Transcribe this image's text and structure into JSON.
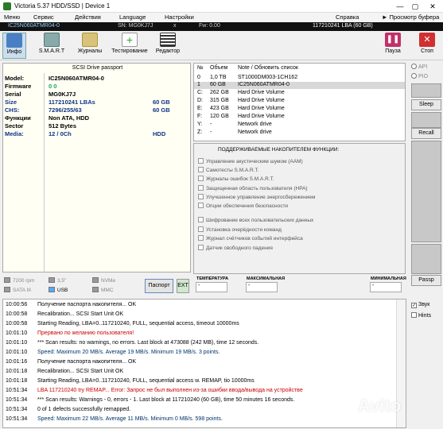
{
  "window": {
    "title": "Victoria 5.37 HDD/SSD | Device 1",
    "controls": [
      "—",
      "▢",
      "✕"
    ]
  },
  "menu": {
    "items": [
      "Меню",
      "Сервис",
      "Действия",
      "Language",
      "Настройки"
    ],
    "right": [
      "Справка",
      "► Просмотр буфера"
    ]
  },
  "status": {
    "model": "IC25N060ATMR04-0",
    "sn": "SN: MG0KJ7J",
    "x": "x",
    "fw": "Fw: 0.00",
    "lba": "117210241 LBA (60 GB)"
  },
  "toolbar": {
    "items": [
      "Инфо",
      "S.M.A.R.T",
      "Журналы",
      "Тестирование",
      "Редактор"
    ],
    "pause": "Пауза",
    "stop": "Стоп"
  },
  "passport": {
    "header": "SCSI  Drive passport",
    "rows": [
      {
        "k": "Model:",
        "v": "IC25N060ATMR04-0",
        "e": ""
      },
      {
        "k": "Firmware",
        "v": "0 0",
        "e": ""
      },
      {
        "k": "Serial",
        "v": "MG0KJ7J",
        "e": ""
      },
      {
        "k": "Size",
        "v": "117210241 LBAs",
        "e": "60 GB"
      },
      {
        "k": "CHS:",
        "v": "7296/255/63",
        "e": "60 GB"
      },
      {
        "k": "Функции",
        "v": "Non ATA, HDD",
        "e": ""
      },
      {
        "k": "Sector",
        "v": "512 Bytes",
        "e": ""
      },
      {
        "k": "Media:",
        "v": "12 / 0Ch",
        "e": "HDD"
      }
    ]
  },
  "drives": {
    "headers": [
      "№",
      "Объем",
      "Note / Обновить список"
    ],
    "rows": [
      {
        "n": "0",
        "size": "1,0 TB",
        "note": "ST1000DM003-1CH162"
      },
      {
        "n": "1",
        "size": "60 GB",
        "note": "IC25N060ATMR04-0"
      },
      {
        "n": "C:",
        "size": "262 GB",
        "note": "Hard Drive Volume"
      },
      {
        "n": "D:",
        "size": "315 GB",
        "note": "Hard Drive Volume"
      },
      {
        "n": "E:",
        "size": "423 GB",
        "note": "Hard Drive Volume"
      },
      {
        "n": "F:",
        "size": "120 GB",
        "note": "Hard Drive Volume"
      },
      {
        "n": "Y:",
        "size": "-",
        "note": "Network drive"
      },
      {
        "n": "Z:",
        "size": "-",
        "note": "Network drive"
      }
    ]
  },
  "functions": {
    "header": "ПОДДЕРЖИВАЕМЫЕ НАКОПИТЕЛЕМ ФУНКЦИИ:",
    "items": [
      "Управление акустическим шумом (AAM)",
      "Самотесты S.M.A.R.T.",
      "Журналы ошибок S.M.A.R.T.",
      "Защищенная область пользователя (HPA)",
      "Улучшенное управление энергосбережением",
      "Опции обеспечения безопасности",
      "Шифрование всех пользовательских данных",
      "Установка очерёдности команд",
      "Журнал счётчиков событий интерфейса",
      "Датчик свободного падения"
    ]
  },
  "right": {
    "api": "API",
    "pio": "PIO",
    "sleep": "Sleep",
    "recall": "Recall",
    "passp": "Passp"
  },
  "legend": {
    "rpm": "7200 rpm",
    "form": "3,5\"",
    "nvme": "NVMe",
    "sata": "SATA III",
    "usb": "USB",
    "mmc": "MMC",
    "passport_btn": "Паспорт",
    "ext_btn": "EXT"
  },
  "temps": {
    "t": "ТЕМПЕРАТУРА",
    "max": "МАКСИМАЛЬНАЯ",
    "min": "МИНИМАЛЬНАЯ",
    "tv": "-",
    "maxv": "-",
    "minv": "-"
  },
  "log": [
    {
      "t": "10:00:56",
      "m": "Получение паспорта накопителя... OK",
      "c": "#000"
    },
    {
      "t": "10:00:58",
      "m": "Recalibration... SCSI  Start Unit OK",
      "c": "#000"
    },
    {
      "t": "10:00:58",
      "m": "Starting Reading, LBA=0..117210240, FULL, sequential access, timeout 10000ms",
      "c": "#000"
    },
    {
      "t": "10:01:10",
      "m": "Прервано по желанию пользователя!",
      "c": "#c00"
    },
    {
      "t": "10:01:10",
      "m": "*** Scan results: no warnings, no errors. Last block at 473088 (242 MB), time 12 seconds.",
      "c": "#000"
    },
    {
      "t": "10:01:10",
      "m": "Speed: Maximum 20 MB/s. Average 19 MB/s. Minimum 19 MB/s. 3 points.",
      "c": "#036"
    },
    {
      "t": "10:01:16",
      "m": "Получение паспорта накопителя... OK",
      "c": "#000"
    },
    {
      "t": "10:01:18",
      "m": "Recalibration... SCSI  Start Unit OK",
      "c": "#000"
    },
    {
      "t": "10:01:18",
      "m": "Starting Reading, LBA=0..117210240, FULL, sequential access w. REMAP, tio 10000ms",
      "c": "#000"
    },
    {
      "t": "10:51:34",
      "m": "LBA 117210240 try REMAP... Error: Запрос не был выполнен из-за ошибки ввода/вывода на устройстве",
      "c": "#c00"
    },
    {
      "t": "10:51:34",
      "m": "*** Scan results: Warnings - 0, errors - 1. Last block at 117210240 (60 GB), time 50 minutes 16 seconds.",
      "c": "#000"
    },
    {
      "t": "10:51:34",
      "m": "0 of 1 defects successfully remapped.",
      "c": "#000"
    },
    {
      "t": "10:51:34",
      "m": "Speed: Maximum 22 MB/s. Average 11 MB/s. Minimum 0 MB/s. 598 points.",
      "c": "#036"
    }
  ],
  "logopts": {
    "sound": "Звук",
    "hints": "Hints"
  },
  "watermark": "Avito"
}
